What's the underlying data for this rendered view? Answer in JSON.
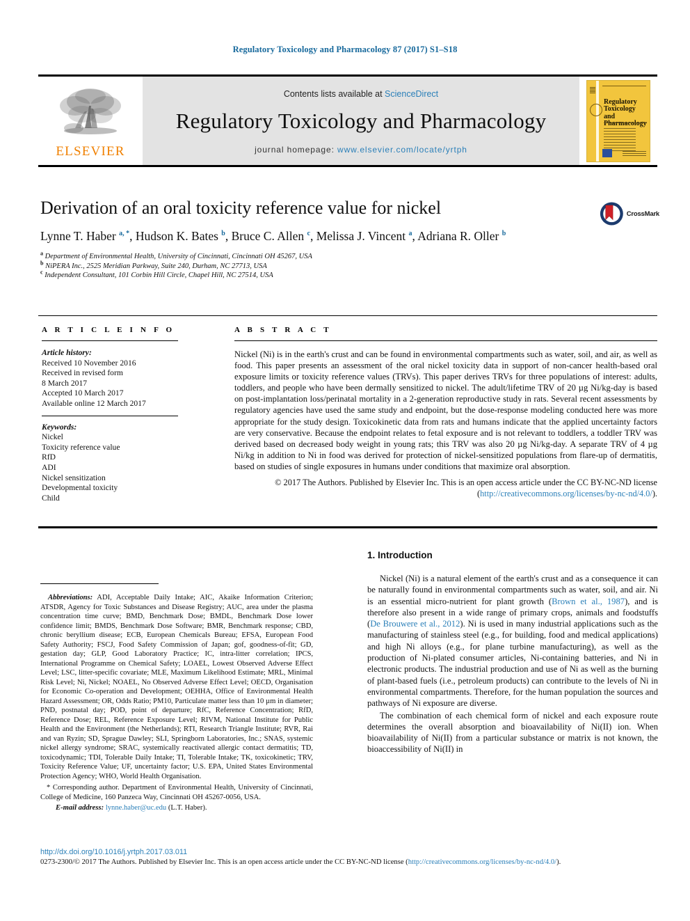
{
  "running_head": "Regulatory Toxicology and Pharmacology 87 (2017) S1–S18",
  "banner": {
    "publisher_logo_text": "ELSEVIER",
    "contents_prefix": "Contents lists available at ",
    "contents_link": "ScienceDirect",
    "journal_title": "Regulatory Toxicology and Pharmacology",
    "homepage_prefix": "journal homepage: ",
    "homepage_url": "www.elsevier.com/locate/yrtph",
    "cover": {
      "title_line1": "Regulatory",
      "title_line2": "Toxicology and",
      "title_line3": "Pharmacology"
    }
  },
  "crossmark": {
    "label": "CrossMark"
  },
  "title": "Derivation of an oral toxicity reference value for nickel",
  "authors_html": "Lynne T. Haber <sup>a, *</sup>, Hudson K. Bates <sup>b</sup>, Bruce C. Allen <sup>c</sup>, Melissa J. Vincent <sup>a</sup>, Adriana R. Oller <sup>b</sup>",
  "affiliations": [
    {
      "marker": "a",
      "text": "Department of Environmental Health, University of Cincinnati, Cincinnati OH 45267, USA"
    },
    {
      "marker": "b",
      "text": "NiPERA Inc., 2525 Meridian Parkway, Suite 240, Durham, NC 27713, USA"
    },
    {
      "marker": "c",
      "text": "Independent Consultant, 101 Corbin Hill Circle, Chapel Hill, NC 27514, USA"
    }
  ],
  "article_info": {
    "heading": "A R T I C L E   I N F O",
    "history_label": "Article history:",
    "history_lines": [
      "Received 10 November 2016",
      "Received in revised form",
      "8 March 2017",
      "Accepted 10 March 2017",
      "Available online 12 March 2017"
    ],
    "keywords_label": "Keywords:",
    "keywords": [
      "Nickel",
      "Toxicity reference value",
      "RfD",
      "ADI",
      "Nickel sensitization",
      "Developmental toxicity",
      "Child"
    ]
  },
  "abstract": {
    "heading": "A B S T R A C T",
    "text": "Nickel (Ni) is in the earth's crust and can be found in environmental compartments such as water, soil, and air, as well as food. This paper presents an assessment of the oral nickel toxicity data in support of non-cancer health-based oral exposure limits or toxicity reference values (TRVs). This paper derives TRVs for three populations of interest: adults, toddlers, and people who have been dermally sensitized to nickel. The adult/lifetime TRV of 20 µg Ni/kg-day is based on post-implantation loss/perinatal mortality in a 2-generation reproductive study in rats. Several recent assessments by regulatory agencies have used the same study and endpoint, but the dose-response modeling conducted here was more appropriate for the study design. Toxicokinetic data from rats and humans indicate that the applied uncertainty factors are very conservative. Because the endpoint relates to fetal exposure and is not relevant to toddlers, a toddler TRV was derived based on decreased body weight in young rats; this TRV was also 20 µg Ni/kg-day. A separate TRV of 4 µg Ni/kg in addition to Ni in food was derived for protection of nickel-sensitized populations from flare-up of dermatitis, based on studies of single exposures in humans under conditions that maximize oral absorption.",
    "copyright_prefix": "© 2017 The Authors. Published by Elsevier Inc. This is an open access article under the CC BY-NC-ND license (",
    "copyright_link": "http://creativecommons.org/licenses/by-nc-nd/4.0/",
    "copyright_suffix": ")."
  },
  "footnotes": {
    "abbreviations_label": "Abbreviations:",
    "abbreviations_text": " ADI, Acceptable Daily Intake; AIC, Akaike Information Criterion; ATSDR, Agency for Toxic Substances and Disease Registry; AUC, area under the plasma concentration time curve; BMD, Benchmark Dose; BMDL, Benchmark Dose lower confidence limit; BMDS, Benchmark Dose Software; BMR, Benchmark response; CBD, chronic beryllium disease; ECB, European Chemicals Bureau; EFSA, European Food Safety Authority; FSCJ, Food Safety Commission of Japan; gof, goodness-of-fit; GD, gestation day; GLP, Good Laboratory Practice; IC, intra-litter correlation; IPCS, International Programme on Chemical Safety; LOAEL, Lowest Observed Adverse Effect Level; LSC, litter-specific covariate; MLE, Maximum Likelihood Estimate; MRL, Minimal Risk Level; Ni, Nickel; NOAEL, No Observed Adverse Effect Level; OECD, Organisation for Economic Co-operation and Development; OEHHA, Office of Environmental Health Hazard Assessment; OR, Odds Ratio; PM10, Particulate matter less than 10 µm in diameter; PND, postnatal day; POD, point of departure; RfC, Reference Concentration; RfD, Reference Dose; REL, Reference Exposure Level; RIVM, National Institute for Public Health and the Environment (the Netherlands); RTI, Research Triangle Institute; RVR, Rai and van Ryzin; SD, Sprague Dawley; SLI, Springborn Laboratories, Inc.; SNAS, systemic nickel allergy syndrome; SRAC, systemically reactivated allergic contact dermatitis; TD, toxicodynamic; TDI, Tolerable Daily Intake; TI, Tolerable Intake; TK, toxicokinetic; TRV, Toxicity Reference Value; UF, uncertainty factor; U.S. EPA, United States Environmental Protection Agency; WHO, World Health Organisation.",
    "corresponding_marker": "*",
    "corresponding_text": " Corresponding author. Department of Environmental Health, University of Cincinnati, College of Medicine, 160 Panzeca Way, Cincinnati OH 45267-0056, USA.",
    "email_label": "E-mail address:",
    "email_address": "lynne.haber@uc.edu",
    "email_owner": " (L.T. Haber)."
  },
  "introduction": {
    "number_and_title": "1. Introduction",
    "paragraphs": [
      {
        "parts": [
          {
            "t": "Nickel (Ni) is a natural element of the earth's crust and as a consequence it can be naturally found in environmental compartments such as water, soil, and air. Ni is an essential micro-nutrient for plant growth (",
            "link": false
          },
          {
            "t": "Brown et al., 1987",
            "link": true
          },
          {
            "t": "), and is therefore also present in a wide range of primary crops, animals and foodstuffs (",
            "link": false
          },
          {
            "t": "De Brouwere et al., 2012",
            "link": true
          },
          {
            "t": "). Ni is used in many industrial applications such as the manufacturing of stainless steel (e.g., for building, food and medical applications) and high Ni alloys (e.g., for plane turbine manufacturing), as well as the production of Ni-plated consumer articles, Ni-containing batteries, and Ni in electronic products. The industrial production and use of Ni as well as the burning of plant-based fuels (i.e., petroleum products) can contribute to the levels of Ni in environmental compartments. Therefore, for the human population the sources and pathways of Ni exposure are diverse.",
            "link": false
          }
        ]
      },
      {
        "parts": [
          {
            "t": "The combination of each chemical form of nickel and each exposure route determines the overall absorption and bioavailability of Ni(II) ion. When bioavailability of Ni(II) from a particular substance or matrix is not known, the bioaccessibility of Ni(II) in",
            "link": false
          }
        ]
      }
    ]
  },
  "bottom": {
    "doi": "http://dx.doi.org/10.1016/j.yrtph.2017.03.011",
    "issn_prefix": "0273-2300/© 2017 The Authors. Published by Elsevier Inc. This is an open access article under the CC BY-NC-ND license (",
    "issn_link": "http://creativecommons.org/licenses/by-nc-nd/4.0/",
    "issn_suffix": ")."
  },
  "colors": {
    "link": "#2a7fb8",
    "running_head": "#17699c",
    "elsevier_orange": "#f08000",
    "banner_bg": "#e3e3e3",
    "cover_yellow": "#f2c53d"
  }
}
